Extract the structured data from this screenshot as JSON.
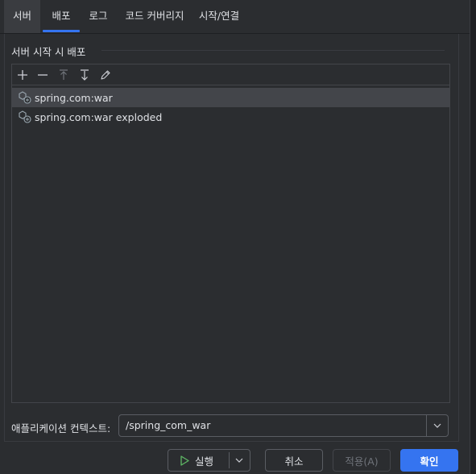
{
  "tabs": [
    "서버",
    "배포",
    "로그",
    "코드 커버리지",
    "시작/연결"
  ],
  "section": {
    "title": "서버 시작 시 배포"
  },
  "toolbar": {
    "add": "+",
    "remove": "—",
    "move_up": "↑",
    "move_down": "↓",
    "edit": "✎"
  },
  "deployments": [
    {
      "label": "spring.com:war",
      "icon": "artifact-icon"
    },
    {
      "label": "spring.com:war exploded",
      "icon": "artifact-icon"
    }
  ],
  "context": {
    "label": "애플리케이션 컨텍스트:",
    "value": "/spring_com_war"
  },
  "footer": {
    "run": "실행",
    "cancel": "취소",
    "apply": "적용(A)",
    "ok": "확인"
  },
  "colors": {
    "background": "#2b2d30",
    "accent": "#3574f0",
    "selection": "#43454a",
    "run_icon": "#5fb865"
  }
}
